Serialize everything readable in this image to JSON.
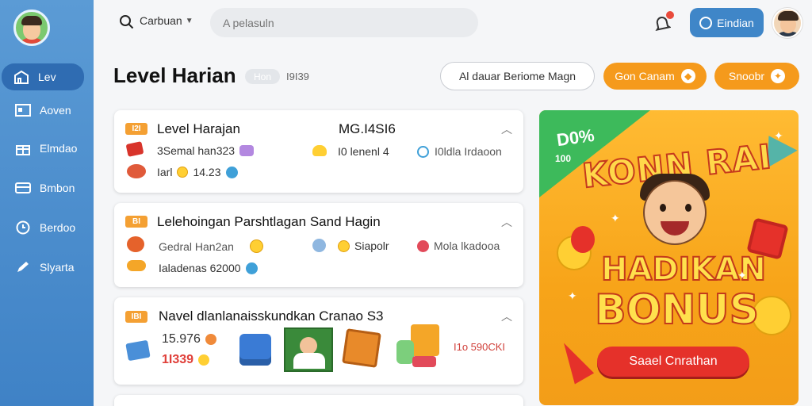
{
  "sidebar": {
    "items": [
      {
        "label": "Lev",
        "icon": "home-icon",
        "active": true
      },
      {
        "label": "Aoven",
        "icon": "inbox-icon",
        "active": false
      },
      {
        "label": "Elmdao",
        "icon": "gift-icon",
        "active": false
      },
      {
        "label": "Bmbon",
        "icon": "card-icon",
        "active": false
      },
      {
        "label": "Berdoo",
        "icon": "clock-icon",
        "active": false
      },
      {
        "label": "Slyarta",
        "icon": "pen-icon",
        "active": false
      }
    ]
  },
  "topbar": {
    "location": "Carbuan",
    "search_placeholder": "A pelasuln",
    "profile_button": "Eindian"
  },
  "header": {
    "title": "Level Harian",
    "pill": "Hon",
    "code": "I9I39",
    "filter_button": "Al dauar Beriome Magn",
    "orange_button_1": "Gon Canam",
    "orange_button_2": "Snoobr"
  },
  "cards": [
    {
      "badge": "I2I",
      "title": "Level Harajan",
      "meta": "MG.I4SI6",
      "line1_text": "3Semal han323",
      "line1_mid": "I0 lenenl 4",
      "line1_right": "I0ldla Irdaoon",
      "line2_prefix": "Iarl",
      "line2_value": "14.23"
    },
    {
      "badge": "BI",
      "title": "Lelehoingan Parshtlagan Sand Hagin",
      "line1_text": "Gedral Han2an",
      "line1_mid": "Siapolr",
      "line1_right": "Mola lkadooa",
      "line2_text": "Ialadenas 62000"
    },
    {
      "badge": "IBI",
      "title": "Navel dlanlanaisskundkan Cranao S3",
      "line1_text": "15.976",
      "line2_text": "1I339",
      "right_text": "I1o 590CKI"
    }
  ],
  "promo": {
    "percent": "D0%",
    "percent_sub": "100",
    "brand": "KONN RAI",
    "headline_1": "HADIKAN",
    "headline_2": "BONUS",
    "cta": "Saael Cnrathan"
  },
  "colors": {
    "sidebar": "#4a8fcf",
    "accent_orange": "#f59a1c",
    "promo_bg": "#f7a419",
    "cta_red": "#e5312a",
    "primary_blue": "#3f86c8"
  }
}
